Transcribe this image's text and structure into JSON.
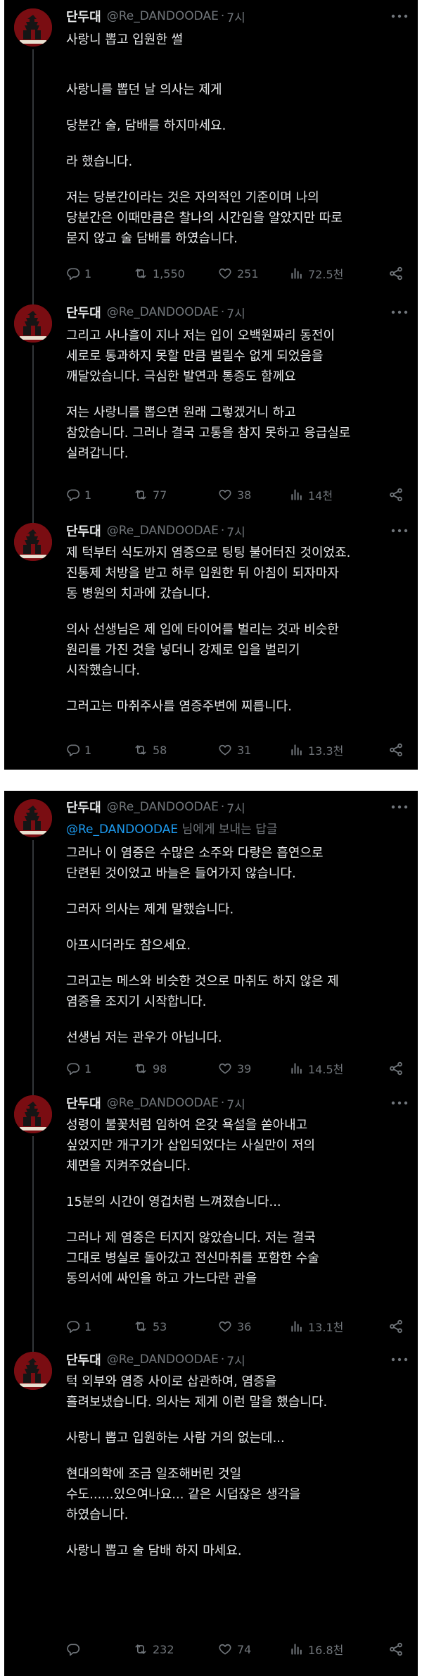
{
  "author": {
    "name": "단두대",
    "handle": "@Re_DANDOODAE",
    "time": "7시"
  },
  "separator": "·",
  "icons": {
    "more": "more-horizontal-icon",
    "reply": "reply-icon",
    "retweet": "retweet-icon",
    "like": "heart-icon",
    "views": "views-icon",
    "share": "share-icon"
  },
  "colors": {
    "background": "#000000",
    "text": "#e7e9ea",
    "muted": "#71767b",
    "link": "#1d9bf0",
    "avatar": "#7a0d12"
  },
  "tweets": [
    {
      "paragraphs": [
        "사랑니 뽑고 입원한 썰",
        "사랑니를 뽑던 날 의사는 제게",
        "당분간 술, 담배를 하지마세요.",
        "라 했습니다.",
        "저는 당분간이라는 것은 자의적인 기준이며 나의\n당분간은 이때만큼은 찰나의 시간임을 알았지만 따로\n묻지 않고 술 담배를 하였습니다."
      ],
      "stats": {
        "replies": "1",
        "retweets": "1,550",
        "likes": "251",
        "views": "72.5천"
      }
    },
    {
      "paragraphs": [
        "그리고 사나흘이 지나 저는 입이 오백원짜리 동전이\n세로로 통과하지 못할 만큼 벌릴수 없게 되었음을\n깨달았습니다. 극심한 발연과 통증도 함께요",
        "저는 사랑니를 뽑으면 원래 그렇겠거니 하고\n참았습니다. 그러나 결국 고통을 참지 못하고 응급실로\n실려갑니다."
      ],
      "stats": {
        "replies": "1",
        "retweets": "77",
        "likes": "38",
        "views": "14천"
      }
    },
    {
      "paragraphs": [
        "제 턱부터 식도까지 염증으로 팅팅 불어터진 것이었죠.\n진통제 처방을 받고 하루 입원한 뒤 아침이 되자마자\n동 병원의 치과에 갔습니다.",
        "의사 선생님은 제 입에 타이어를 벌리는 것과 비슷한\n원리를 가진 것을 넣더니 강제로 입을 벌리기\n시작했습니다.",
        "그러고는 마취주사를 염증주변에 찌릅니다."
      ],
      "stats": {
        "replies": "1",
        "retweets": "58",
        "likes": "31",
        "views": "13.3천"
      }
    },
    {
      "reply_to": {
        "mention": "@Re_DANDOODAE",
        "suffix": " 님에게 보내는 답글"
      },
      "paragraphs": [
        "그러나 이 염증은 수많은 소주와 다량은 흡연으로\n단련된 것이었고 바늘은 들어가지 않습니다.",
        "그러자 의사는 제게 말했습니다.",
        "아프시더라도 참으세요.",
        "그러고는 메스와 비슷한 것으로 마취도 하지 않은 제\n염증을 조지기 시작합니다.",
        "선생님 저는 관우가 아닙니다."
      ],
      "stats": {
        "replies": "1",
        "retweets": "98",
        "likes": "39",
        "views": "14.5천"
      }
    },
    {
      "paragraphs": [
        "성령이 불꽃처럼 임하여 온갖 욕설을 쏟아내고\n싶었지만 개구기가 삽입되었다는 사실만이 저의\n체면을 지켜주었습니다.",
        "15분의 시간이 영겁처럼 느껴졌습니다...",
        "그러나 제 염증은 터지지 않았습니다. 저는 결국\n그대로 병실로 돌아갔고 전신마취를 포함한 수술\n동의서에 싸인을 하고 가느다란 관을"
      ],
      "stats": {
        "replies": "1",
        "retweets": "53",
        "likes": "36",
        "views": "13.1천"
      }
    },
    {
      "paragraphs": [
        "턱 외부와 염증 사이로 삽관하여, 염증을\n흘려보냈습니다. 의사는 제게 이런 말을 했습니다.",
        "사랑니 뽑고 입원하는 사람 거의 없는데...",
        "현대의학에 조금 일조해버린 것일\n수도......있으여나요... 같은 시덥잖은 생각을\n하였습니다.",
        "사랑니 뽑고 술 담배 하지 마세요."
      ],
      "stats": {
        "replies": "",
        "retweets": "232",
        "likes": "74",
        "views": "16.8천"
      }
    }
  ]
}
